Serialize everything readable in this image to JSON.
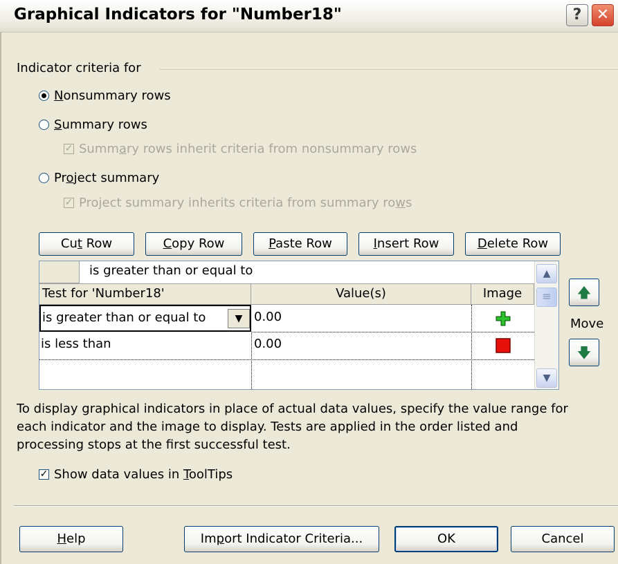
{
  "window": {
    "title": "Graphical Indicators for \"Number18\"",
    "help_glyph": "?",
    "close_glyph": "✕"
  },
  "criteria": {
    "group_label": "Indicator criteria for",
    "nonsummary_rows": {
      "pre": "",
      "accel": "N",
      "post": "onsummary rows",
      "checked": true
    },
    "summary_rows": {
      "pre": "",
      "accel": "S",
      "post": "ummary rows",
      "checked": false
    },
    "summary_inherit": {
      "pre": "Summ",
      "accel": "a",
      "post": "ry rows inherit criteria from nonsummary rows",
      "checked": true,
      "enabled": false
    },
    "project_summary": {
      "pre": "Pr",
      "accel": "o",
      "post": "ject summary",
      "checked": false
    },
    "project_inherit": {
      "pre": "Project summary inherits criteria from summary ro",
      "accel": "w",
      "post": "s",
      "checked": true,
      "enabled": false
    }
  },
  "row_buttons": {
    "cut": {
      "pre": "Cu",
      "accel": "t",
      "post": " Row"
    },
    "copy": {
      "pre": "",
      "accel": "C",
      "post": "opy Row"
    },
    "paste": {
      "pre": "",
      "accel": "P",
      "post": "aste Row"
    },
    "insert": {
      "pre": "",
      "accel": "I",
      "post": "nsert Row"
    },
    "delete": {
      "pre": "",
      "accel": "D",
      "post": "elete Row"
    }
  },
  "grid": {
    "edit_value": "is greater than or equal to",
    "headers": {
      "test": "Test for 'Number18'",
      "values": "Value(s)",
      "image": "Image"
    },
    "rows": [
      {
        "test": "is greater than or equal to",
        "value": "0.00",
        "image": "green-plus-icon",
        "image_color": "#1FA01F"
      },
      {
        "test": "is less than",
        "value": "0.00",
        "image": "red-square-icon",
        "image_color": "#E8100A"
      },
      {
        "test": "",
        "value": "",
        "image": ""
      }
    ]
  },
  "move": {
    "label": "Move"
  },
  "description": "To display graphical indicators in place of actual data values, specify the value range for each indicator and the image to display.  Tests are applied in the order listed and processing stops at the first successful test.",
  "tooltips": {
    "pre": "Show data values in ",
    "accel": "T",
    "post": "oolTips",
    "checked": true
  },
  "footer": {
    "help": {
      "pre": "",
      "accel": "H",
      "post": "elp"
    },
    "import": {
      "pre": "Im",
      "accel": "p",
      "post": "ort Indicator Criteria..."
    },
    "ok": "OK",
    "cancel": "Cancel"
  }
}
